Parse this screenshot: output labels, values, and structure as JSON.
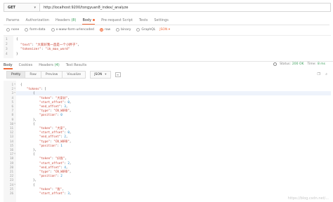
{
  "request": {
    "method": "GET",
    "url": "http://localhost:9200/tongyuan8_index/_analyze"
  },
  "request_tabs": [
    {
      "label": "Params",
      "count": "",
      "active": false
    },
    {
      "label": "Authorization",
      "count": "",
      "active": false
    },
    {
      "label": "Headers",
      "count": "(8)",
      "active": false
    },
    {
      "label": "Body",
      "count": "",
      "active": true
    },
    {
      "label": "Pre-request Script",
      "count": "",
      "active": false
    },
    {
      "label": "Tests",
      "count": "",
      "active": false
    },
    {
      "label": "Settings",
      "count": "",
      "active": false
    }
  ],
  "body_types": [
    {
      "label": "none",
      "selected": false
    },
    {
      "label": "form-data",
      "selected": false
    },
    {
      "label": "x-www-form-urlencoded",
      "selected": false
    },
    {
      "label": "raw",
      "selected": true
    },
    {
      "label": "binary",
      "selected": false
    },
    {
      "label": "GraphQL",
      "selected": false
    }
  ],
  "body_format": "JSON ▾",
  "request_body": {
    "lines": [
      {
        "n": "1",
        "text": "{"
      },
      {
        "n": "2",
        "key": "\"text\"",
        "value": "\"大家好我一直是一个小胖子\""
      },
      {
        "n": "3",
        "key": "\"tokenizer\"",
        "value": "\"ik_max_word\""
      },
      {
        "n": "4",
        "text": "}"
      }
    ]
  },
  "response_tabs": [
    {
      "label": "Body",
      "count": "",
      "active": true
    },
    {
      "label": "Cookies",
      "count": "",
      "active": false
    },
    {
      "label": "Headers",
      "count": "(4)",
      "active": false
    },
    {
      "label": "Test Results",
      "count": "",
      "active": false
    }
  ],
  "response_status": {
    "status_label": "Status:",
    "status_value": "200 OK",
    "time_label": "Time:",
    "time_value": "8 ms"
  },
  "response_views": [
    {
      "label": "Pretty",
      "active": true
    },
    {
      "label": "Raw",
      "active": false
    },
    {
      "label": "Preview",
      "active": false
    },
    {
      "label": "Visualize",
      "active": false
    }
  ],
  "response_format": "JSON",
  "response_body": [
    {
      "n": "1",
      "t": "{",
      "indent": 0
    },
    {
      "n": "2",
      "k": "\"tokens\"",
      "t": ": [",
      "indent": 1
    },
    {
      "n": "3",
      "t": "{",
      "indent": 2
    },
    {
      "n": "4",
      "k": "\"token\"",
      "s": "\"大家好\"",
      "t": ",",
      "indent": 3
    },
    {
      "n": "5",
      "k": "\"start_offset\"",
      "v": "0",
      "t": ",",
      "indent": 3
    },
    {
      "n": "6",
      "k": "\"end_offset\"",
      "v": "3",
      "t": ",",
      "indent": 3
    },
    {
      "n": "7",
      "k": "\"type\"",
      "s": "\"CN_WORD\"",
      "t": ",",
      "indent": 3
    },
    {
      "n": "8",
      "k": "\"position\"",
      "v": "0",
      "t": "",
      "indent": 3
    },
    {
      "n": "9",
      "t": "},",
      "indent": 2
    },
    {
      "n": "10",
      "t": "{",
      "indent": 2
    },
    {
      "n": "11",
      "k": "\"token\"",
      "s": "\"大家\"",
      "t": ",",
      "indent": 3
    },
    {
      "n": "12",
      "k": "\"start_offset\"",
      "v": "0",
      "t": ",",
      "indent": 3
    },
    {
      "n": "13",
      "k": "\"end_offset\"",
      "v": "2",
      "t": ",",
      "indent": 3
    },
    {
      "n": "14",
      "k": "\"type\"",
      "s": "\"CN_WORD\"",
      "t": ",",
      "indent": 3
    },
    {
      "n": "15",
      "k": "\"position\"",
      "v": "1",
      "t": "",
      "indent": 3
    },
    {
      "n": "16",
      "t": "},",
      "indent": 2
    },
    {
      "n": "17",
      "t": "{",
      "indent": 2
    },
    {
      "n": "18",
      "k": "\"token\"",
      "s": "\"好我\"",
      "t": ",",
      "indent": 3
    },
    {
      "n": "19",
      "k": "\"start_offset\"",
      "v": "2",
      "t": ",",
      "indent": 3
    },
    {
      "n": "20",
      "k": "\"end_offset\"",
      "v": "4",
      "t": ",",
      "indent": 3
    },
    {
      "n": "21",
      "k": "\"type\"",
      "s": "\"CN_WORD\"",
      "t": ",",
      "indent": 3
    },
    {
      "n": "22",
      "k": "\"position\"",
      "v": "2",
      "t": "",
      "indent": 3
    },
    {
      "n": "23",
      "t": "},",
      "indent": 2
    },
    {
      "n": "24",
      "t": "{",
      "indent": 2
    },
    {
      "n": "25",
      "k": "\"token\"",
      "s": "\"我\"",
      "t": ",",
      "indent": 3
    },
    {
      "n": "26",
      "k": "\"start_offset\"",
      "v": "3",
      "t": ",",
      "indent": 3
    }
  ],
  "watermark": "https://blog.csdn.net/..."
}
